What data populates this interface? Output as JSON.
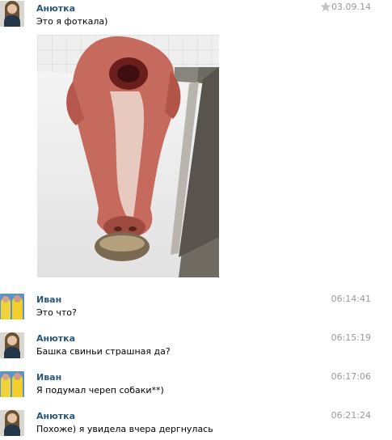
{
  "messages": [
    {
      "sender": "Анютка",
      "time": "03.09.14",
      "text": "Это я фоткала)"
    },
    {
      "sender": "Иван",
      "time": "06:14:41",
      "text": "Это что?"
    },
    {
      "sender": "Анютка",
      "time": "06:15:19",
      "text": "Башка свиньи страшная да?"
    },
    {
      "sender": "Иван",
      "time": "06:17:06",
      "text": "Я подумал череп собаки**)"
    },
    {
      "sender": "Анютка",
      "time": "06:21:24",
      "text": "Похоже) я увидела вчера дергнулась"
    }
  ],
  "colors": {
    "sender_name": "#2b587a",
    "timestamp": "#999999",
    "text": "#000000",
    "background": "#ffffff"
  },
  "icons": {
    "favorite": "star-icon"
  }
}
